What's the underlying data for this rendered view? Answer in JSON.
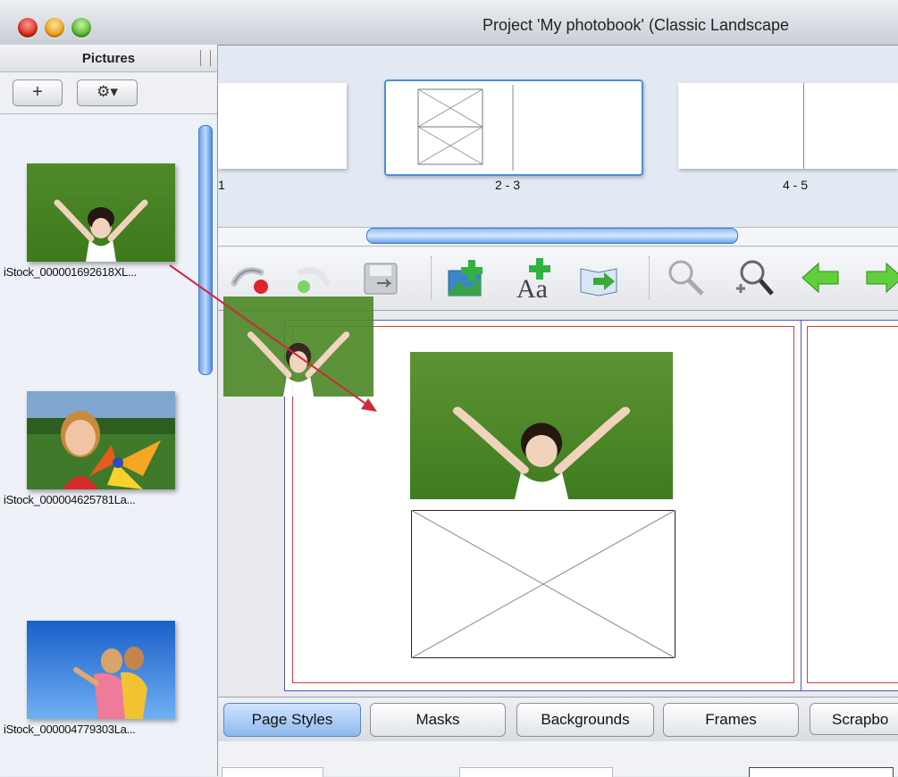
{
  "window": {
    "title": "Project 'My photobook' (Classic Landscape"
  },
  "sidebar": {
    "title": "Pictures",
    "add_label": "+",
    "gear_label": "⚙▾",
    "pictures": [
      {
        "filename": "iStock_000001692618XL..."
      },
      {
        "filename": "iStock_000004625781La..."
      },
      {
        "filename": "iStock_000004779303La..."
      }
    ]
  },
  "strip": {
    "spreads": [
      {
        "label": "1"
      },
      {
        "label": "2 - 3"
      },
      {
        "label": "4 - 5"
      }
    ]
  },
  "toolbar": {
    "icons": [
      "undo-icon",
      "redo-icon",
      "save-icon",
      "add-photo-icon",
      "add-text-icon",
      "add-page-icon",
      "zoom-out-icon",
      "zoom-in-icon",
      "previous-page-icon",
      "next-page-icon"
    ]
  },
  "tabs": [
    {
      "label": "Page Styles",
      "active": true
    },
    {
      "label": "Masks",
      "active": false
    },
    {
      "label": "Backgrounds",
      "active": false
    },
    {
      "label": "Frames",
      "active": false
    },
    {
      "label": "Scrapbo",
      "active": false
    }
  ],
  "colors": {
    "accent_blue": "#4b8ee0",
    "drag_arrow": "#d0283a",
    "bleed_red": "#d43a3a",
    "page_border": "#4a56c8"
  }
}
